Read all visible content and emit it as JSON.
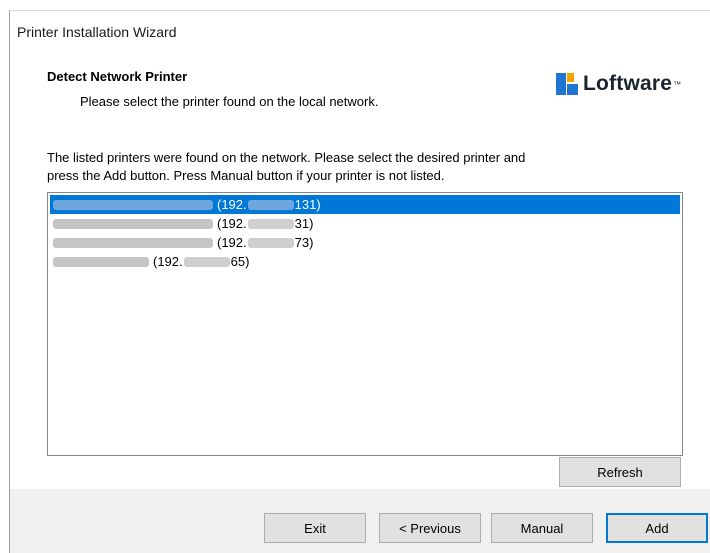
{
  "window": {
    "title": "Printer Installation Wizard"
  },
  "header": {
    "title": "Detect Network Printer",
    "subtitle": "Please select the printer found on the local network.",
    "logo_text": "Loftware",
    "logo_tm": "™"
  },
  "description": {
    "line1": "The listed printers were found on the network. Please select the desired printer and",
    "line2": "press the Add button. Press Manual button if your printer is not listed."
  },
  "printers": [
    {
      "address_prefix": "(192.",
      "address_suffix": "131)",
      "selected": true
    },
    {
      "address_prefix": "(192.",
      "address_suffix": "31)",
      "selected": false
    },
    {
      "address_prefix": "(192.",
      "address_suffix": "73)",
      "selected": false
    },
    {
      "address_prefix": "(192.",
      "address_suffix": "65)",
      "selected": false
    }
  ],
  "buttons": {
    "refresh": "Refresh",
    "exit": "Exit",
    "previous": "< Previous",
    "manual": "Manual",
    "add": "Add"
  },
  "colors": {
    "selection": "#0078d7",
    "logo_blue": "#1f75d1",
    "logo_orange": "#f4a300"
  }
}
